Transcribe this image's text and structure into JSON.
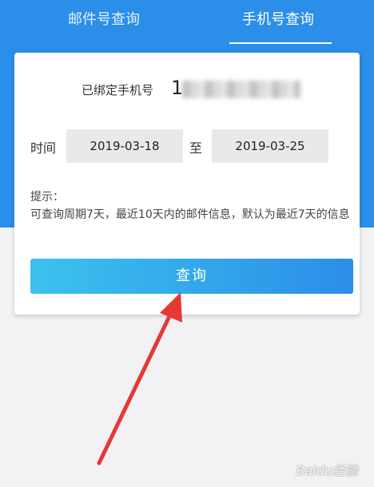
{
  "tabs": {
    "mail": "邮件号查询",
    "phone": "手机号查询"
  },
  "card": {
    "bind_label": "已绑定手机号",
    "bind_phone": "1",
    "time_label": "时间",
    "date_start": "2019-03-18",
    "to_label": "至",
    "date_end": "2019-03-25",
    "hint_title": "提示：",
    "hint_text": "可查询周期7天，最近10天内的邮件信息，默认为最近7天的信息",
    "query_button": "查询"
  },
  "watermark": "Baidu经验",
  "colors": {
    "header_blue": "#2b8ee8",
    "button_start": "#3cc2ee",
    "button_end": "#2b8ee8",
    "arrow_red": "#e53935"
  }
}
